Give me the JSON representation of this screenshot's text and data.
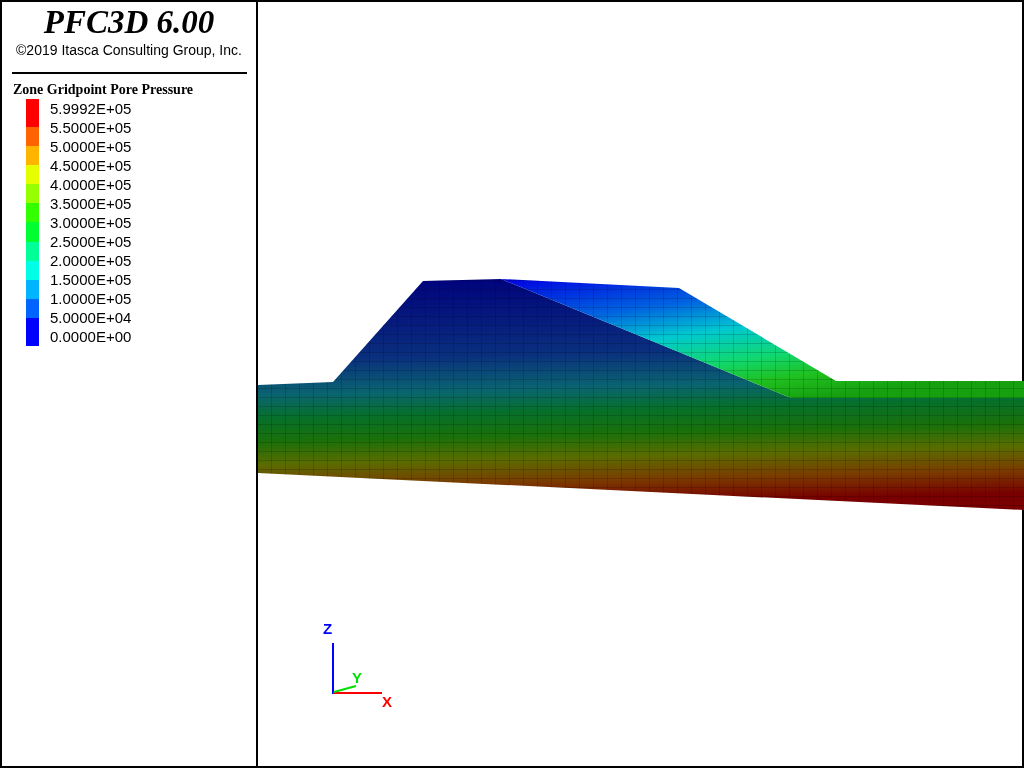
{
  "header": {
    "title": "PFC3D 6.00",
    "copyright": "©2019 Itasca Consulting Group, Inc."
  },
  "legend": {
    "title": "Zone Gridpoint Pore Pressure",
    "labels": [
      "5.9992E+05",
      "5.5000E+05",
      "5.0000E+05",
      "4.5000E+05",
      "4.0000E+05",
      "3.5000E+05",
      "3.0000E+05",
      "2.5000E+05",
      "2.0000E+05",
      "1.5000E+05",
      "1.0000E+05",
      "5.0000E+04",
      "0.0000E+00"
    ],
    "bands": [
      {
        "color": "#ff0000"
      },
      {
        "color": "#ff6400"
      },
      {
        "color": "#ffb400"
      },
      {
        "color": "#e6ff00"
      },
      {
        "color": "#96ff00"
      },
      {
        "color": "#32ff00"
      },
      {
        "color": "#00ff32"
      },
      {
        "color": "#00ff96"
      },
      {
        "color": "#00ffe6"
      },
      {
        "color": "#00b4ff"
      },
      {
        "color": "#0064ff"
      },
      {
        "color": "#0000ff"
      }
    ]
  },
  "axes": [
    {
      "kind": "z",
      "text": "Z"
    },
    {
      "kind": "y",
      "text": "Y"
    },
    {
      "kind": "x",
      "text": "X"
    }
  ]
}
